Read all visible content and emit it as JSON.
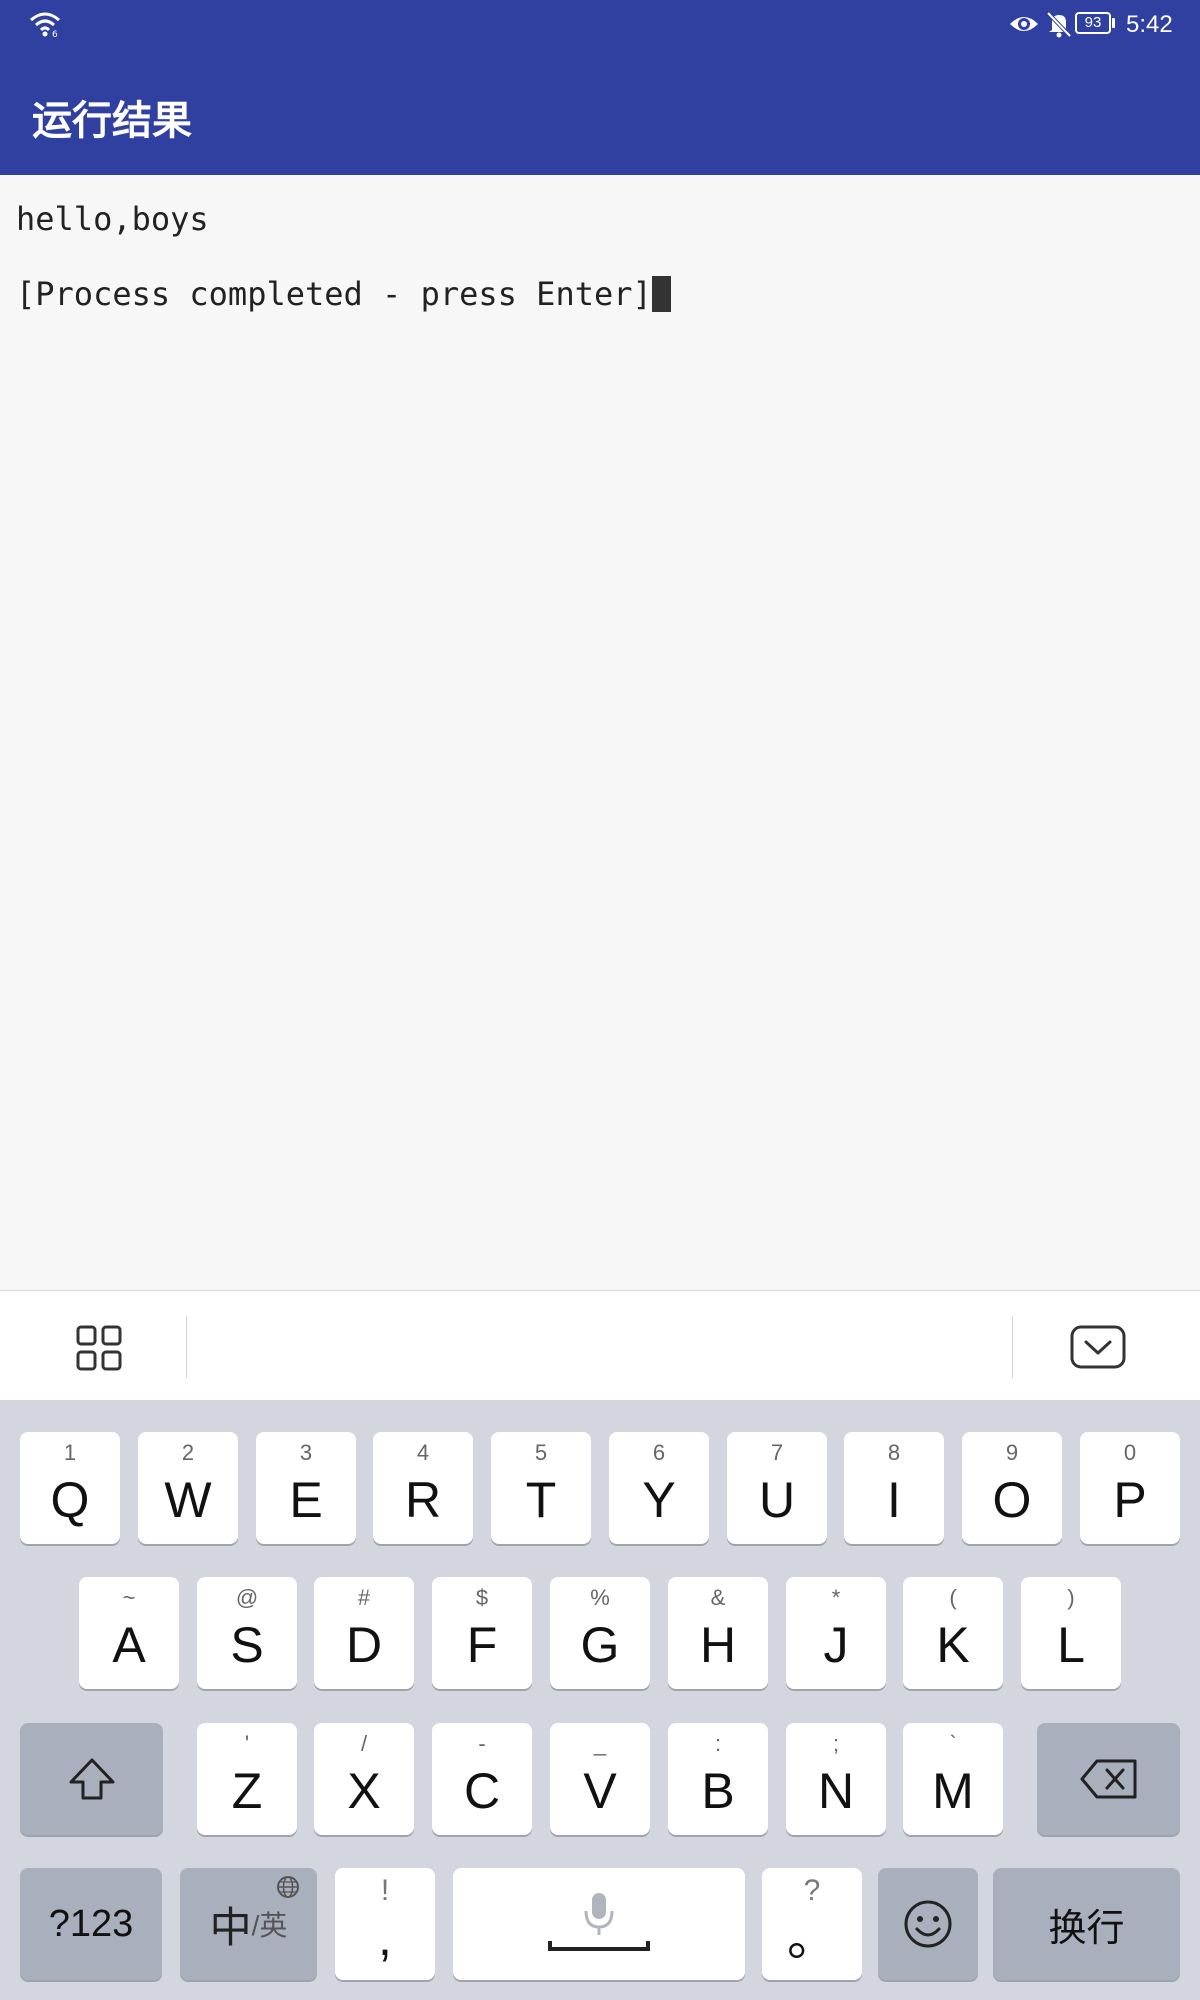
{
  "status_bar": {
    "time": "5:42",
    "battery": "93",
    "icons": [
      "wifi-icon",
      "eye-icon",
      "bell-off-icon",
      "battery-icon"
    ]
  },
  "app_bar": {
    "title": "运行结果"
  },
  "terminal": {
    "lines": [
      "hello,boys",
      "[Process completed - press Enter]"
    ]
  },
  "keyboard": {
    "toolbar": {
      "left_icon": "grid-icon",
      "right_icon": "hide-keyboard-icon"
    },
    "row1": [
      {
        "main": "Q",
        "sub": "1"
      },
      {
        "main": "W",
        "sub": "2"
      },
      {
        "main": "E",
        "sub": "3"
      },
      {
        "main": "R",
        "sub": "4"
      },
      {
        "main": "T",
        "sub": "5"
      },
      {
        "main": "Y",
        "sub": "6"
      },
      {
        "main": "U",
        "sub": "7"
      },
      {
        "main": "I",
        "sub": "8"
      },
      {
        "main": "O",
        "sub": "9"
      },
      {
        "main": "P",
        "sub": "0"
      }
    ],
    "row2": [
      {
        "main": "A",
        "sub": "~"
      },
      {
        "main": "S",
        "sub": "@"
      },
      {
        "main": "D",
        "sub": "#"
      },
      {
        "main": "F",
        "sub": "$"
      },
      {
        "main": "G",
        "sub": "%"
      },
      {
        "main": "H",
        "sub": "&"
      },
      {
        "main": "J",
        "sub": "*"
      },
      {
        "main": "K",
        "sub": "("
      },
      {
        "main": "L",
        "sub": ")"
      }
    ],
    "row3": [
      {
        "main": "Z",
        "sub": "'"
      },
      {
        "main": "X",
        "sub": "/"
      },
      {
        "main": "C",
        "sub": "-"
      },
      {
        "main": "V",
        "sub": "_"
      },
      {
        "main": "B",
        "sub": ":"
      },
      {
        "main": "N",
        "sub": ";"
      },
      {
        "main": "M",
        "sub": "`"
      }
    ],
    "bottom": {
      "symbols": "?123",
      "lang_main": "中",
      "lang_sub": "/英",
      "comma_main": ",",
      "comma_sub": "!",
      "period_main": "。",
      "period_sub": "?",
      "enter": "换行"
    }
  },
  "colors": {
    "primary": "#2f40a1",
    "keyboard_bg": "#d3d6de",
    "key_dark": "#a9afbc"
  }
}
